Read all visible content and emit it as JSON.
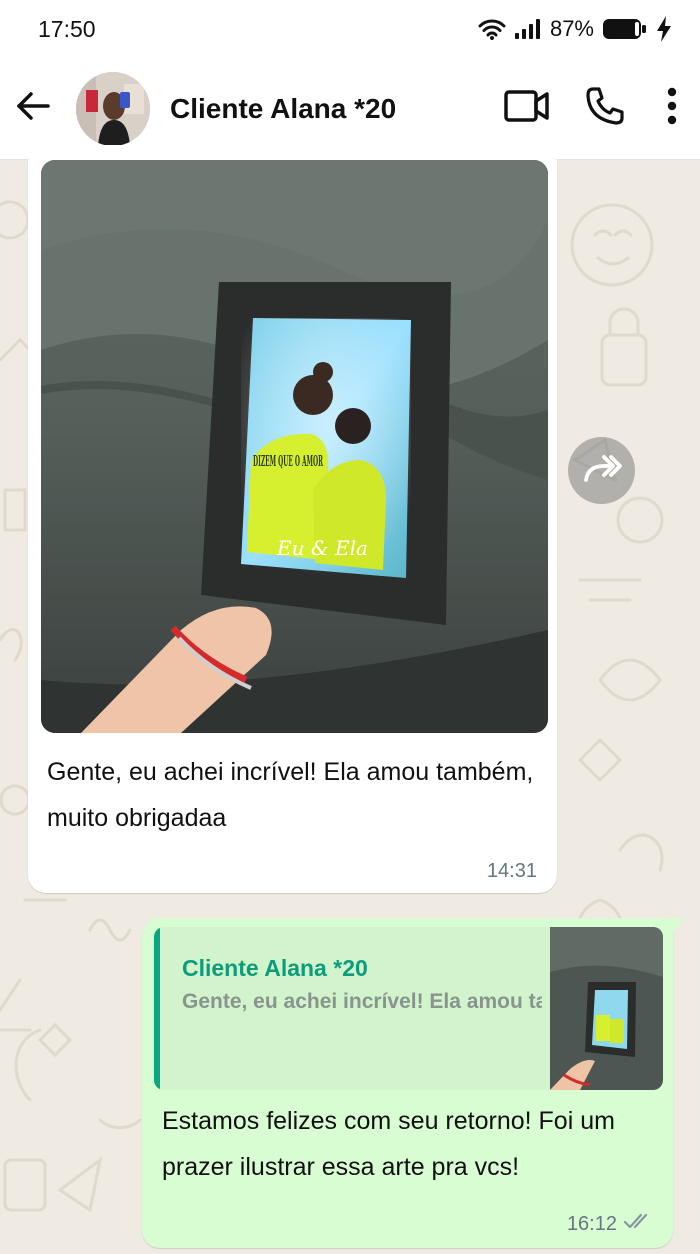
{
  "status_bar": {
    "time": "17:50",
    "battery": "87%"
  },
  "header": {
    "contact_name": "Cliente Alana *20",
    "icons": [
      "back-arrow-icon",
      "video-call-icon",
      "voice-call-icon",
      "more-options-icon"
    ]
  },
  "messages": [
    {
      "direction": "incoming",
      "image_caption_text": "Eu & Ela",
      "image_shirt_text": "DIZEM QUE O AMOR",
      "text": "Gente, eu achei incrível! Ela amou também, muito obrigadaa",
      "time": "14:31"
    },
    {
      "direction": "outgoing",
      "quote": {
        "author": "Cliente Alana *20",
        "text": "Gente, eu achei incrível! Ela amou também, muito obrigadaa"
      },
      "text": "Estamos felizes com seu retorno! Foi um prazer ilustrar essa arte pra vcs!",
      "time": "16:12",
      "status": "read"
    }
  ],
  "colors": {
    "outgoing_bubble": "#d9fdd3",
    "quote_accent": "#06a884",
    "chat_background": "#efeae2",
    "read_ticks": "#8696a0"
  }
}
